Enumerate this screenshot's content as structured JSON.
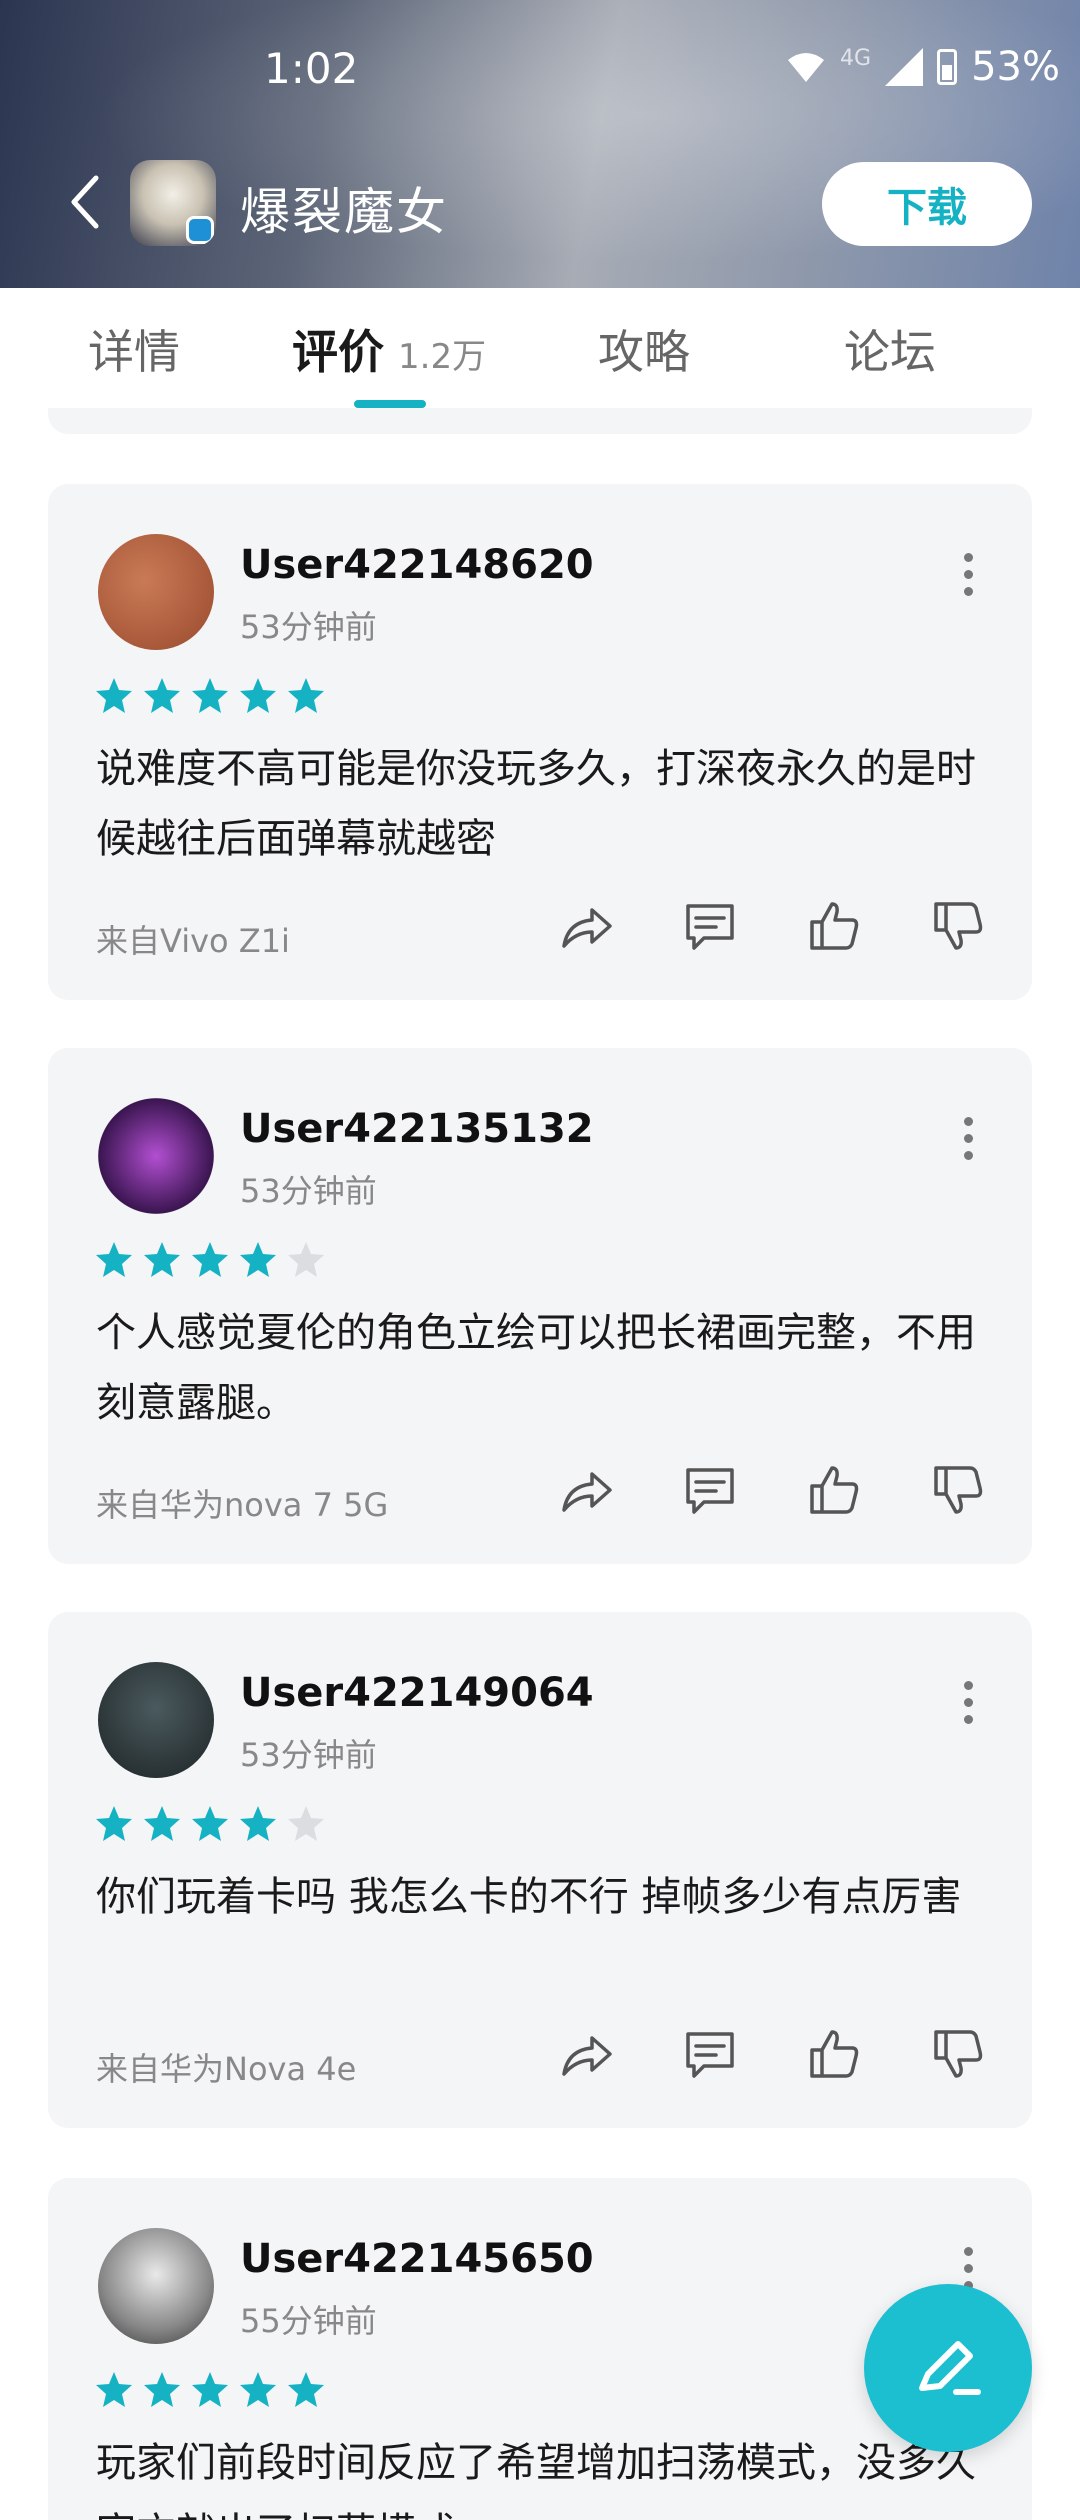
{
  "status_bar": {
    "time": "1:02",
    "network": "4G",
    "battery": "53%"
  },
  "header": {
    "app_name": "爆裂魔女",
    "download_label": "下载"
  },
  "tabs": [
    {
      "label": "详情"
    },
    {
      "label": "评价",
      "count": "1.2万"
    },
    {
      "label": "攻略"
    },
    {
      "label": "论坛"
    }
  ],
  "reviews": [
    {
      "user": "User422148620",
      "time": "53分钟前",
      "rating": 5,
      "text": "说难度不高可能是你没玩多久，打深夜永久的是时候越往后面弹幕就越密",
      "device": "来自Vivo Z1i"
    },
    {
      "user": "User422135132",
      "time": "53分钟前",
      "rating": 4,
      "text": "个人感觉夏伦的角色立绘可以把长裙画完整，不用刻意露腿。",
      "device": "来自华为nova 7 5G"
    },
    {
      "user": "User422149064",
      "time": "53分钟前",
      "rating": 4,
      "text": "你们玩着卡吗 我怎么卡的不行 掉帧多少有点厉害",
      "device": "来自华为Nova 4e"
    },
    {
      "user": "User422145650",
      "time": "55分钟前",
      "rating": 5,
      "text": "玩家们前段时间反应了希望增加扫荡模式，没多久官方就出了扫荡模式",
      "device": ""
    }
  ],
  "colors": {
    "accent": "#15b2c3",
    "star_filled": "#15b2c3",
    "star_empty": "#dcdde0",
    "card_bg": "#f4f5f7"
  }
}
